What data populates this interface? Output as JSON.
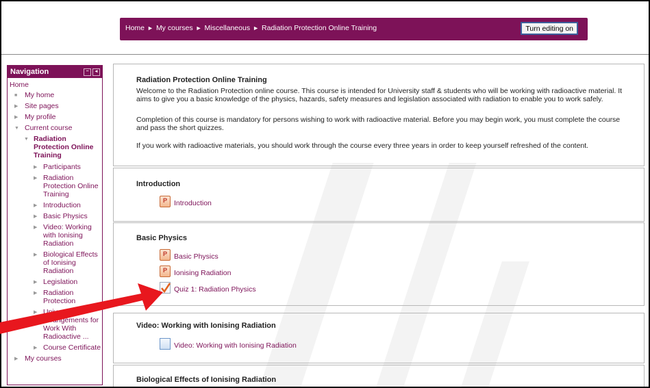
{
  "breadcrumb": [
    "Home",
    "My courses",
    "Miscellaneous",
    "Radiation Protection Online Training"
  ],
  "breadcrumb_separator": "►",
  "edit_button_label": "Turn editing on",
  "colors": {
    "brand": "#7d1258",
    "annotation_arrow": "#e8171e"
  },
  "navigation": {
    "title": "Navigation",
    "home": "Home",
    "my_home": "My home",
    "site_pages": "Site pages",
    "my_profile": "My profile",
    "current_course": "Current course",
    "course_name": "Radiation Protection Online Training",
    "course_items": [
      "Participants",
      "Radiation Protection Online Training",
      "Introduction",
      "Basic Physics",
      "Video: Working with Ionising Radiation",
      "Biological Effects of Ionising Radiation",
      "Legislation",
      "Radiation Protection",
      "University Arrangements for Work With Radioactive ...",
      "Course Certificate"
    ],
    "my_courses": "My courses"
  },
  "course": {
    "title": "Radiation Protection Online Training",
    "paragraphs": [
      "Welcome to the Radiation Protection online course. This course is intended for University staff & students who will be working with radioactive material. It aims to give you a basic knowledge of the physics, hazards, safety measures and legislation associated with radiation to enable you to work safely.",
      "Completion of this course is mandatory for persons wishing to work with radioactive material. Before you may begin work, you must complete the course and pass the short quizzes.",
      "If you work with radioactive materials, you should work through the course every three years in order to keep yourself refreshed of the content."
    ]
  },
  "sections": [
    {
      "title": "Introduction",
      "activities": [
        {
          "label": "Introduction",
          "icon": "powerpoint-icon"
        }
      ]
    },
    {
      "title": "Basic Physics",
      "activities": [
        {
          "label": "Basic Physics",
          "icon": "powerpoint-icon"
        },
        {
          "label": "Ionising Radiation",
          "icon": "powerpoint-icon"
        },
        {
          "label": "Quiz 1: Radiation Physics",
          "icon": "quiz-icon"
        }
      ]
    },
    {
      "title": "Video: Working with Ionising Radiation",
      "activities": [
        {
          "label": "Video: Working with Ionising Radiation",
          "icon": "video-icon"
        }
      ]
    },
    {
      "title": "Biological Effects of Ionising Radiation",
      "activities": []
    }
  ]
}
